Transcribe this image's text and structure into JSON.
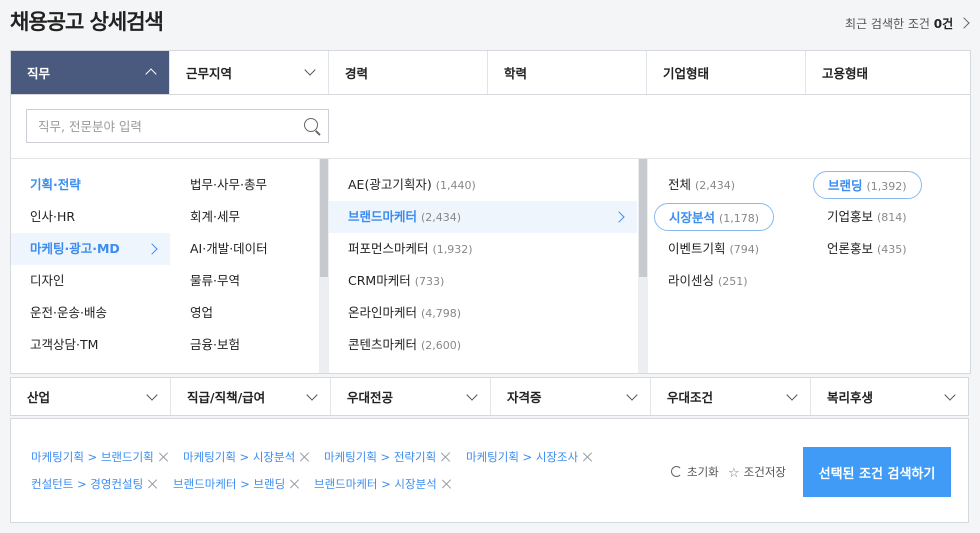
{
  "page": {
    "title": "채용공고 상세검색"
  },
  "recent": {
    "label": "최근 검색한 조건",
    "count": "0건"
  },
  "tabs": [
    {
      "label": "직무"
    },
    {
      "label": "근무지역"
    },
    {
      "label": "경력"
    },
    {
      "label": "학력"
    },
    {
      "label": "기업형태"
    },
    {
      "label": "고용형태"
    }
  ],
  "search": {
    "placeholder": "직무, 전문분야 입력"
  },
  "col1": [
    {
      "label": "기획·전략"
    },
    {
      "label": "인사·HR"
    },
    {
      "label": "마케팅·광고·MD"
    },
    {
      "label": "디자인"
    },
    {
      "label": "운전·운송·배송"
    },
    {
      "label": "고객상담·TM"
    }
  ],
  "col2": [
    {
      "label": "법무·사무·총무"
    },
    {
      "label": "회계·세무"
    },
    {
      "label": "AI·개발·데이터"
    },
    {
      "label": "물류·무역"
    },
    {
      "label": "영업"
    },
    {
      "label": "금융·보험"
    }
  ],
  "col3": [
    {
      "label": "AE(광고기획자)",
      "count": "(1,440)"
    },
    {
      "label": "브랜드마케터",
      "count": "(2,434)"
    },
    {
      "label": "퍼포먼스마케터",
      "count": "(1,932)"
    },
    {
      "label": "CRM마케터",
      "count": "(733)"
    },
    {
      "label": "온라인마케터",
      "count": "(4,798)"
    },
    {
      "label": "콘텐츠마케터",
      "count": "(2,600)"
    }
  ],
  "col4": [
    {
      "label": "전체",
      "count": "(2,434)"
    },
    {
      "label": "브랜딩",
      "count": "(1,392)"
    },
    {
      "label": "시장분석",
      "count": "(1,178)"
    },
    {
      "label": "기업홍보",
      "count": "(814)"
    },
    {
      "label": "이벤트기획",
      "count": "(794)"
    },
    {
      "label": "언론홍보",
      "count": "(435)"
    },
    {
      "label": "라이센싱",
      "count": "(251)"
    }
  ],
  "tabs2": [
    {
      "label": "산업"
    },
    {
      "label": "직급/직책/급여"
    },
    {
      "label": "우대전공"
    },
    {
      "label": "자격증"
    },
    {
      "label": "우대조건"
    },
    {
      "label": "복리후생"
    }
  ],
  "chips": [
    {
      "label": "마케팅기획 > 브랜드기획"
    },
    {
      "label": "마케팅기획 > 시장분석"
    },
    {
      "label": "마케팅기획 > 전략기획"
    },
    {
      "label": "마케팅기획 > 시장조사"
    },
    {
      "label": "컨설턴트 > 경영컨설팅"
    },
    {
      "label": "브랜드마케터 > 브랜딩"
    },
    {
      "label": "브랜드마케터 > 시장분석"
    }
  ],
  "actions": {
    "reset": "초기화",
    "save": "조건저장",
    "search": "선택된 조건 검색하기"
  },
  "colors": {
    "accent": "#3d8df0",
    "tab_active": "#4a5a7e",
    "button": "#3f9bf6"
  }
}
